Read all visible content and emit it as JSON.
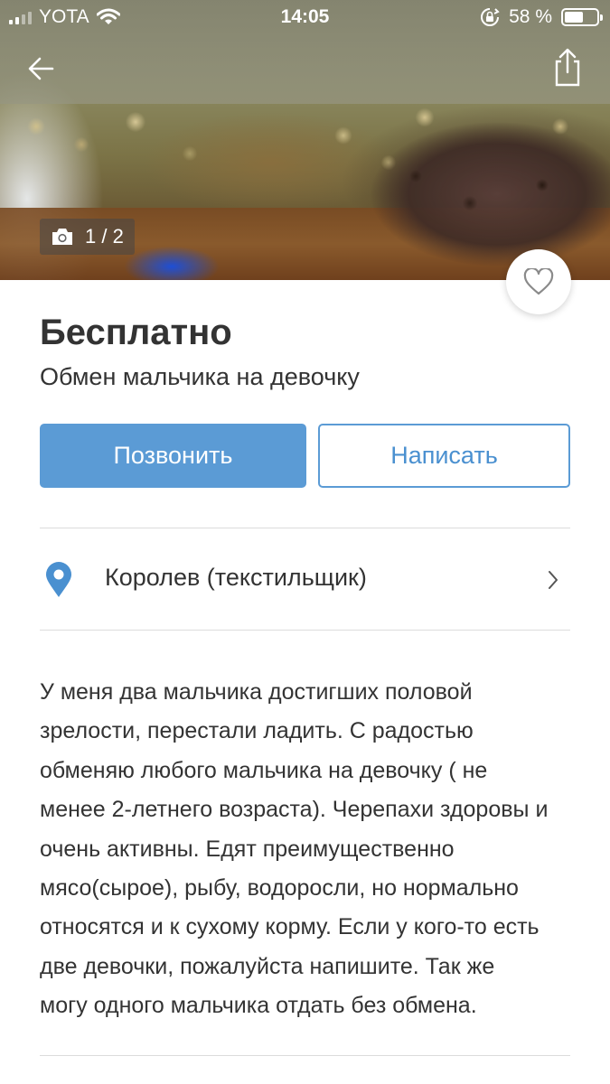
{
  "status_bar": {
    "carrier": "YOTA",
    "time": "14:05",
    "battery_percent": "58 %",
    "battery_level": 0.58
  },
  "nav": {
    "back_icon": "arrow-left-icon",
    "share_icon": "share-icon"
  },
  "gallery": {
    "counter": "1 / 2",
    "camera_icon": "camera-icon"
  },
  "favorite": {
    "icon": "heart-outline-icon"
  },
  "listing": {
    "price": "Бесплатно",
    "title": "Обмен мальчика на девочку"
  },
  "actions": {
    "call_label": "Позвонить",
    "write_label": "Написать"
  },
  "location": {
    "text": "Королев (текстильщик)",
    "icon": "location-pin-icon",
    "color": "#4a90d0"
  },
  "description": [
    "У меня два мальчика достигших половой",
    "зрелости, перестали ладить. С радостью",
    "обменяю любого мальчика на девочку ( не",
    "менее 2-летнего возраста). Черепахи здоровы и",
    "очень активны. Едят преимущественно",
    "мясо(сырое), рыбу, водоросли, но нормально",
    "относятся и к сухому корму. Если у кого-то есть",
    "две девочки, пожалуйста напишите. Так же",
    "могу одного мальчика отдать без обмена."
  ],
  "colors": {
    "accent": "#5b9bd5",
    "text": "#333333",
    "divider": "#dcdcdc"
  }
}
